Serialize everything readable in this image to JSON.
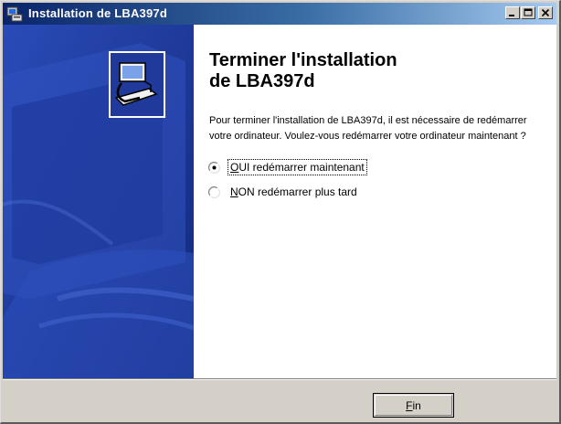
{
  "window": {
    "title": "Installation de LBA397d"
  },
  "main": {
    "heading": "Terminer l'installation\nde LBA397d",
    "message": "Pour terminer l'installation de LBA397d, il est nécessaire de redémarrer votre ordinateur. Voulez-vous redémarrer votre ordinateur maintenant ?",
    "options": [
      {
        "label": "OUI redémarrer maintenant",
        "selected": true
      },
      {
        "label": "NON redémarrer plus tard",
        "selected": false
      }
    ]
  },
  "footer": {
    "finish_label": "Fin"
  },
  "colors": {
    "titlebar_start": "#0a246a",
    "titlebar_end": "#a6caf0",
    "side_panel": "#1a3595",
    "dialog_face": "#d4d0c8"
  },
  "icons": [
    "installer-app-icon",
    "minimize-icon",
    "maximize-icon",
    "close-icon",
    "computer-install-icon"
  ]
}
